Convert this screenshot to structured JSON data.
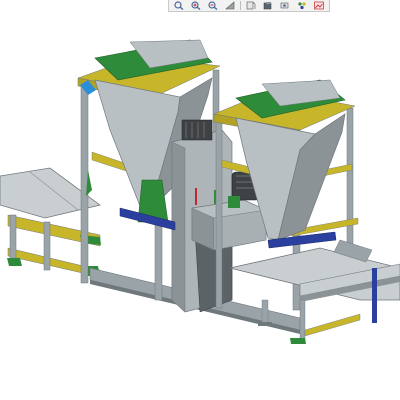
{
  "app": {
    "window_title": ""
  },
  "toolbar": {
    "buttons": [
      {
        "icon": "zoom-fit-icon"
      },
      {
        "icon": "zoom-in-icon"
      },
      {
        "icon": "zoom-out-icon"
      },
      {
        "icon": "view-orientation-icon"
      },
      {
        "icon": "section-view-icon"
      },
      {
        "icon": "display-style-icon"
      },
      {
        "icon": "hide-show-icon"
      },
      {
        "icon": "appearance-icon"
      },
      {
        "icon": "scene-icon"
      }
    ]
  },
  "viewport": {
    "model": "bagging-machine-assembly",
    "colors": {
      "background": "#ffffff",
      "frame": "#9aa3a8",
      "frame_dark": "#6f787d",
      "yellow_rail": "#c7b52a",
      "green": "#2e8b3a",
      "blue": "#2a3f9e",
      "red": "#c2262b",
      "hopper": "#b9c0c3",
      "hopper_dark": "#8c9397",
      "conveyor": "#c9cfd1",
      "motor": "#3e4245"
    }
  }
}
